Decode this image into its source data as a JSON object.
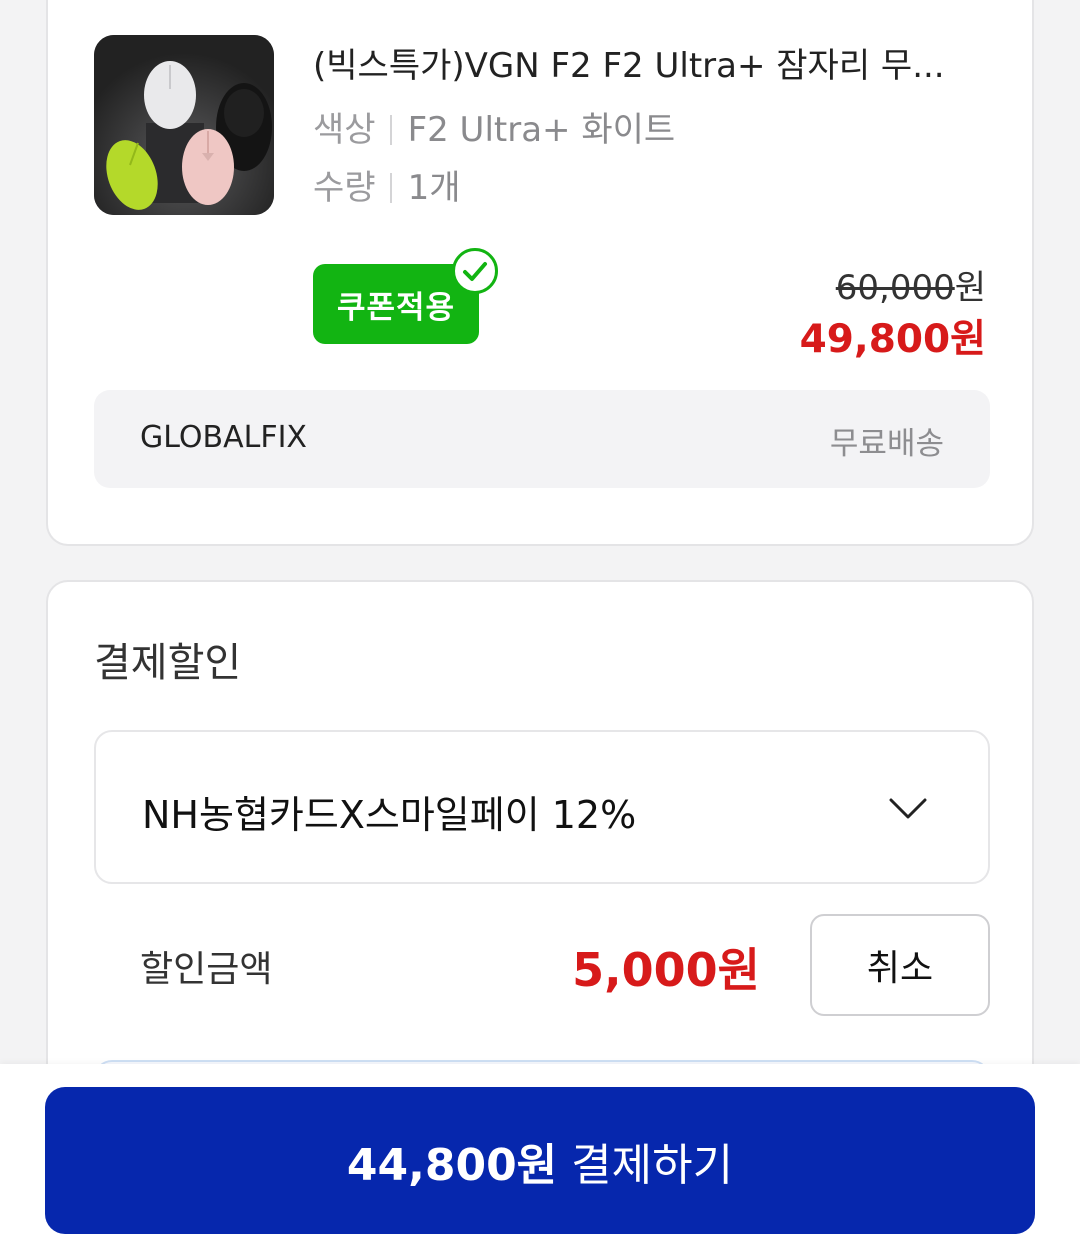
{
  "product": {
    "title": "(빅스특가)VGN F2 F2 Ultra+ 잠자리 무...",
    "option_color_key": "색상",
    "option_color_value": "F2 Ultra+ 화이트",
    "option_qty_key": "수량",
    "option_qty_value": "1개",
    "coupon_badge": "쿠폰적용",
    "original_price": "60,000",
    "original_price_unit": "원",
    "sale_price": "49,800원",
    "seller": "GLOBALFIX",
    "shipping_fee": "무료배송",
    "thumbnail_icon": "gaming-mouse-product-image",
    "sale_color": "#d71a1a"
  },
  "discount": {
    "section_title": "결제할인",
    "selected_option": "NH농협카드X스마일페이 12%",
    "amount_label": "할인금액",
    "amount_value": "5,000원",
    "cancel_label": "취소"
  },
  "footer": {
    "pay_amount": "44,800원",
    "pay_label": "결제하기",
    "button_color": "#0627ad"
  }
}
